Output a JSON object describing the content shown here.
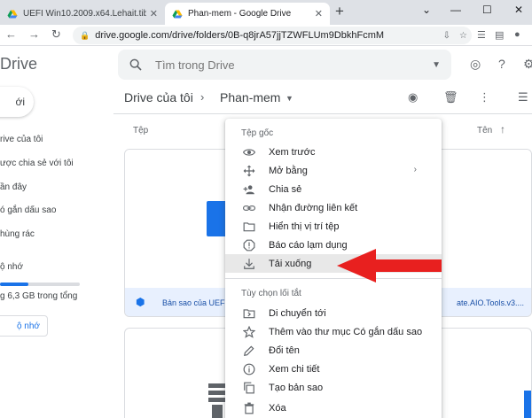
{
  "browser": {
    "tabs": [
      {
        "title": "UEFI Win10.2009.x64.Lehait.tib -"
      },
      {
        "title": "Phan-mem - Google Drive"
      }
    ],
    "url": "drive.google.com/drive/folders/0B-q8jrA57jjTZWFLUm9DbkhFcmM"
  },
  "drive": {
    "title": "Drive",
    "search_placeholder": "Tìm trong Drive",
    "new_label": "ới",
    "sidebar": {
      "items": [
        {
          "label": "rive của tôi"
        },
        {
          "label": "ược chia sẻ với tôi"
        },
        {
          "label": "ần đây"
        },
        {
          "label": "ó gắn dấu sao"
        },
        {
          "label": "hùng rác"
        }
      ],
      "storage_label": "ộ nhớ",
      "storage_text": "g 6,3 GB trong tổng",
      "storage_fraction": 0.35,
      "buy_label": "ộ nhớ"
    },
    "breadcrumb": {
      "root": "Drive của tôi",
      "sep": "›",
      "current": "Phan-mem"
    },
    "columns": {
      "name": "Tệp",
      "sort": "Tên"
    },
    "files": [
      {
        "name_left": "Bản sao của UEF",
        "name_right": "ate.AIO.Tools.v3...."
      }
    ]
  },
  "context_menu": {
    "section1": "Tệp gốc",
    "items1": [
      {
        "label": "Xem trước",
        "icon": "eye-icon"
      },
      {
        "label": "Mở bằng",
        "icon": "move-icon",
        "submenu": "›"
      },
      {
        "label": "Chia sẻ",
        "icon": "person-add-icon"
      },
      {
        "label": "Nhận đường liên kết",
        "icon": "link-icon"
      },
      {
        "label": "Hiển thị vị trí tệp",
        "icon": "folder-icon"
      },
      {
        "label": "Báo cáo lạm dụng",
        "icon": "report-icon"
      },
      {
        "label": "Tải xuống",
        "icon": "download-icon"
      }
    ],
    "section2": "Tùy chọn lối tắt",
    "items2": [
      {
        "label": "Di chuyển tới",
        "icon": "move-to-icon"
      },
      {
        "label": "Thêm vào thư mục Có gắn dấu sao",
        "icon": "star-icon"
      },
      {
        "label": "Đổi tên",
        "icon": "edit-icon"
      },
      {
        "label": "Xem chi tiết",
        "icon": "info-icon"
      },
      {
        "label": "Tạo bản sao",
        "icon": "copy-icon"
      },
      {
        "label": "Xóa",
        "icon": "trash-icon"
      }
    ]
  },
  "colors": {
    "accent": "#1a73e8",
    "annotation": "#e8201f",
    "highlight": "#e8e8e8"
  }
}
